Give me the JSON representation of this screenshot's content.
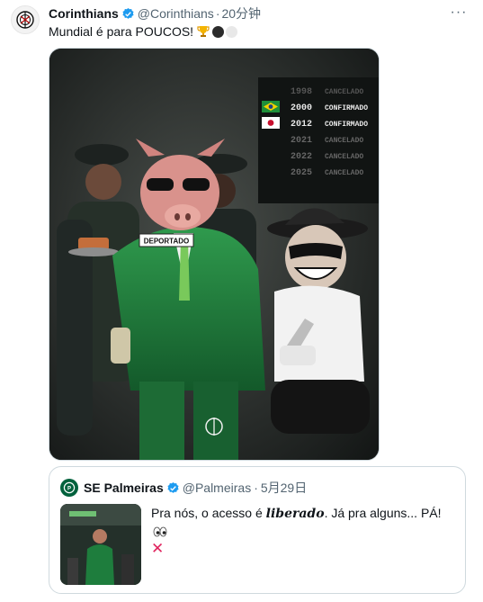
{
  "tweet": {
    "author_name": "Corinthians",
    "handle": "@Corinthians",
    "separator": "·",
    "time": "20分钟",
    "more_label": "···",
    "text": "Mundial é para POUCOS!",
    "emoji": [
      "trophy",
      "black-circle",
      "white-circle"
    ]
  },
  "media": {
    "pig_tag": "DEPORTADO",
    "board": [
      {
        "year": "1998",
        "status": "CANCELADO",
        "flag": "",
        "active": false
      },
      {
        "year": "2000",
        "status": "CONFIRMADO",
        "flag": "brazil",
        "active": true
      },
      {
        "year": "2012",
        "status": "CONFIRMADO",
        "flag": "japan",
        "active": true
      },
      {
        "year": "2021",
        "status": "CANCELADO",
        "flag": "",
        "active": false
      },
      {
        "year": "2022",
        "status": "CANCELADO",
        "flag": "",
        "active": false
      },
      {
        "year": "2025",
        "status": "CANCELADO",
        "flag": "",
        "active": false
      }
    ]
  },
  "quote": {
    "author_name": "SE Palmeiras",
    "handle": "@Palmeiras",
    "separator": "·",
    "date": "5月29日",
    "text_before": "Pra nós, o acesso é ",
    "text_emphasis": "liberado",
    "text_after": ". Já pra alguns... PÁ!",
    "trailing_emoji": [
      "eyes",
      "cross-mark"
    ]
  },
  "colors": {
    "verified_blue": "#1d9bf0",
    "muted_text": "#536471",
    "palmeiras_green": "#00613c",
    "cross_red": "#e0245e"
  }
}
